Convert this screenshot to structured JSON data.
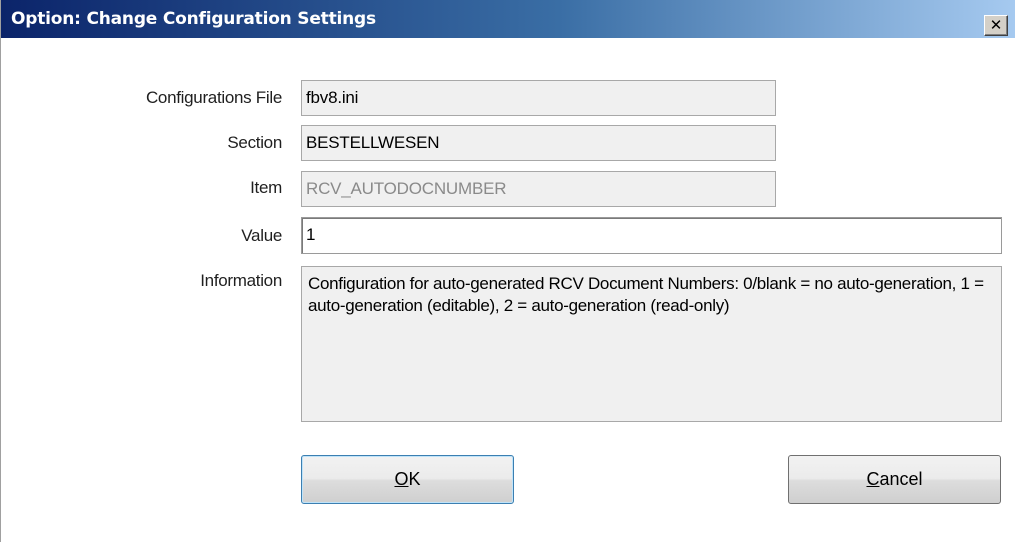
{
  "window": {
    "title": "Option: Change Configuration Settings",
    "close_icon": "close-icon",
    "close_glyph": "✕"
  },
  "form": {
    "config_file": {
      "label": "Configurations File",
      "value": "fbv8.ini"
    },
    "section": {
      "label": "Section",
      "value": "BESTELLWESEN"
    },
    "item": {
      "label": "Item",
      "value": "RCV_AUTODOCNUMBER"
    },
    "value": {
      "label": "Value",
      "value": "1"
    },
    "information": {
      "label": "Information",
      "text": "Configuration for auto-generated RCV Document Numbers: 0/blank = no auto-generation, 1 = auto-generation (editable), 2 = auto-generation (read-only)"
    }
  },
  "buttons": {
    "ok": {
      "accel": "O",
      "rest": "K"
    },
    "cancel": {
      "accel": "C",
      "rest": "ancel"
    }
  },
  "colors": {
    "titlebar_start": "#0b246a",
    "titlebar_end": "#a6caf0",
    "field_bg": "#f0f0f0",
    "default_button_border": "#3c7fb1"
  }
}
